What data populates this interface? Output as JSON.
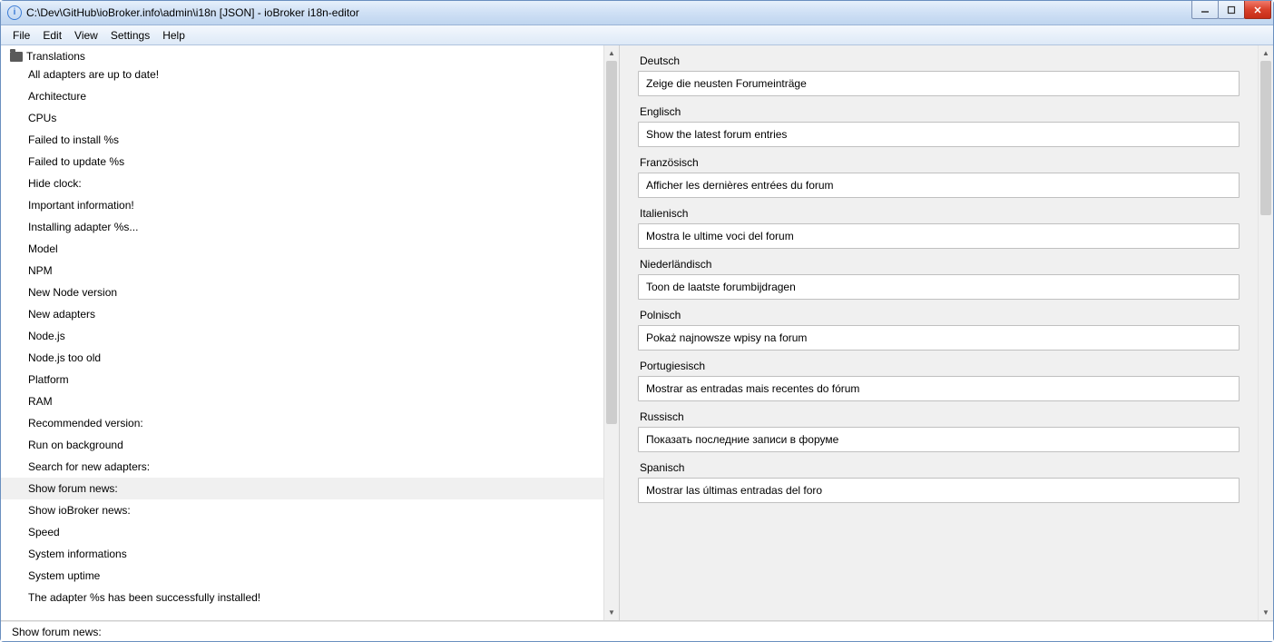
{
  "window": {
    "title": "C:\\Dev\\GitHub\\ioBroker.info\\admin\\i18n [JSON] - ioBroker i18n-editor"
  },
  "menu": {
    "items": [
      "File",
      "Edit",
      "View",
      "Settings",
      "Help"
    ]
  },
  "tree": {
    "root": "Translations",
    "items": [
      "All adapters are up to date!",
      "Architecture",
      "CPUs",
      "Failed to install %s",
      "Failed to update %s",
      "Hide clock:",
      "Important information!",
      "Installing adapter %s...",
      "Model",
      "NPM",
      "New Node version",
      "New adapters",
      "Node.js",
      "Node.js too old",
      "Platform",
      "RAM",
      "Recommended version:",
      "Run on background",
      "Search for new adapters:",
      "Show forum news:",
      "Show ioBroker news:",
      "Speed",
      "System informations",
      "System uptime",
      "The adapter %s has been successfully installed!"
    ],
    "selectedIndex": 19
  },
  "editor": {
    "fields": [
      {
        "label": "Deutsch",
        "value": "Zeige die neusten Forumeinträge"
      },
      {
        "label": "Englisch",
        "value": "Show the latest forum entries"
      },
      {
        "label": "Französisch",
        "value": "Afficher les dernières entrées du forum"
      },
      {
        "label": "Italienisch",
        "value": "Mostra le ultime voci del forum"
      },
      {
        "label": "Niederländisch",
        "value": "Toon de laatste forumbijdragen"
      },
      {
        "label": "Polnisch",
        "value": "Pokaż najnowsze wpisy na forum"
      },
      {
        "label": "Portugiesisch",
        "value": "Mostrar as entradas mais recentes do fórum"
      },
      {
        "label": "Russisch",
        "value": "Показать последние записи в форуме"
      },
      {
        "label": "Spanisch",
        "value": "Mostrar las últimas entradas del foro"
      }
    ]
  },
  "status": {
    "text": "Show forum news:"
  }
}
